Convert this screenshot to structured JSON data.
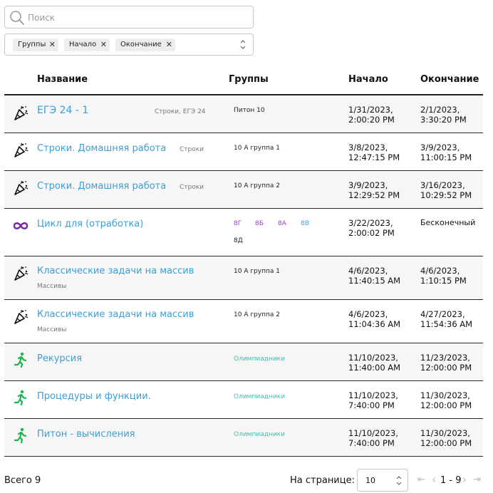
{
  "search": {
    "placeholder": "Поиск",
    "value": ""
  },
  "filter": {
    "chips": [
      "Группы",
      "Начало",
      "Окончание"
    ],
    "remove_glyph": "✕"
  },
  "table": {
    "headers": [
      "Название",
      "Группы",
      "Начало",
      "Окончание"
    ],
    "rows": [
      {
        "icon": "party-popper-icon",
        "title": "ЕГЭ 24 - 1",
        "subtitle": "Строки, ЕГЭ 24",
        "groups": [
          "Питон 10"
        ],
        "start": [
          "1/31/2023,",
          "2:00:20 PM"
        ],
        "end": [
          "2/1/2023,",
          "3:30:20 PM"
        ]
      },
      {
        "icon": "party-popper-icon",
        "title": "Строки. Домашняя работа",
        "subtitle": "Строки",
        "groups": [
          "10 А группа 1"
        ],
        "start": [
          "3/8/2023,",
          "12:47:15 PM"
        ],
        "end": [
          "3/9/2023,",
          "11:00:15 PM"
        ]
      },
      {
        "icon": "party-popper-icon",
        "title": "Строки. Домашняя работа",
        "subtitle": "Строки",
        "groups": [
          "10 А группа 2"
        ],
        "start": [
          "3/9/2023,",
          "12:29:52 PM"
        ],
        "end": [
          "3/16/2023,",
          "10:29:52 PM"
        ]
      },
      {
        "icon": "infinity-icon",
        "title": "Цикл для (отработка)",
        "subtitle": "",
        "groups": [
          "8Г",
          "8Б",
          "8А",
          "8В",
          "8Д"
        ],
        "start": [
          "3/22/2023,",
          "2:00:02 PM"
        ],
        "end": [
          "Бесконечный"
        ]
      },
      {
        "icon": "party-popper-icon",
        "title": "Классические задачи на массив",
        "subtitle": "Массивы",
        "groups": [
          "10 А группа 1"
        ],
        "start": [
          "4/6/2023,",
          "11:40:15 AM"
        ],
        "end": [
          "4/6/2023,",
          "1:10:15 PM"
        ]
      },
      {
        "icon": "party-popper-icon",
        "title": "Классические задачи на массив",
        "subtitle": "Массивы",
        "groups": [
          "10 А группа 2"
        ],
        "start": [
          "4/6/2023,",
          "11:04:36 AM"
        ],
        "end": [
          "4/27/2023,",
          "11:54:36 AM"
        ]
      },
      {
        "icon": "running-person-icon",
        "title": "Рекурсия",
        "subtitle": "",
        "groups": [
          "Олимпиадники"
        ],
        "start": [
          "11/10/2023,",
          "11:40:00 AM"
        ],
        "end": [
          "11/23/2023,",
          "12:00:00 PM"
        ]
      },
      {
        "icon": "running-person-icon",
        "title": "Процедуры и функции.",
        "subtitle": "",
        "groups": [
          "Олимпиадники"
        ],
        "start": [
          "11/10/2023,",
          "7:40:00 PM"
        ],
        "end": [
          "11/30/2023,",
          "12:00:00 PM"
        ]
      },
      {
        "icon": "running-person-icon",
        "title": "Питон - вычисления",
        "subtitle": "",
        "groups": [
          "Олимпиадники"
        ],
        "start": [
          "11/10/2023,",
          "7:40:00 PM"
        ],
        "end": [
          "11/30/2023,",
          "12:00:00 PM"
        ]
      }
    ]
  },
  "group_colors": {
    "8Г": "#9b40c8",
    "8Б": "#9b40c8",
    "8А": "#9b40c8",
    "8В": "#4aa3d9",
    "8Д": "#222222",
    "Олимпиадники": "#3cc0b4"
  },
  "colors": {
    "link": "#3a9fd6",
    "infinity": "#7a22a8",
    "runner": "#19b34a"
  },
  "footer": {
    "total": "Всего 9",
    "per_page_label": "На странице:",
    "per_page_value": "10",
    "first_glyph": "⇤",
    "prev_glyph": "‹",
    "range": "1 - 9",
    "next_glyph": "›",
    "last_glyph": "⇥"
  }
}
